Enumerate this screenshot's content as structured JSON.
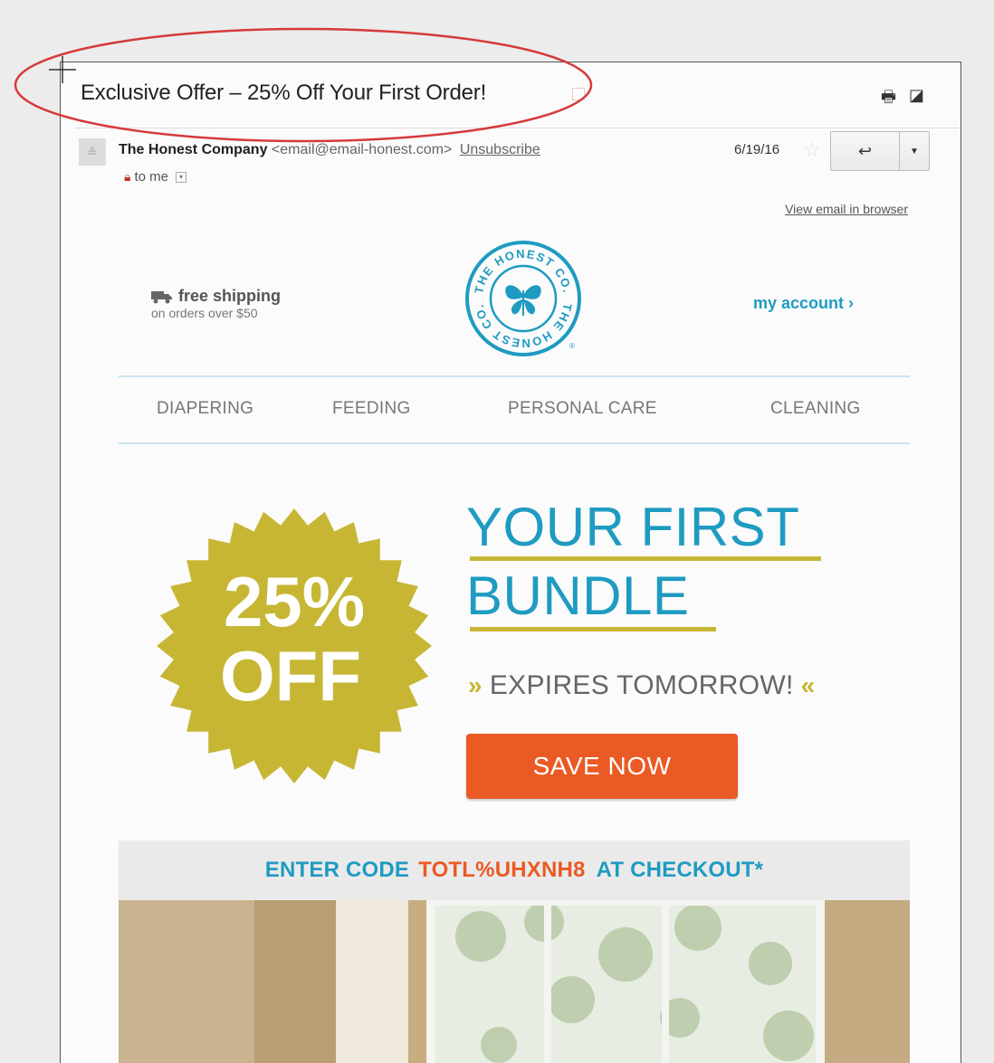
{
  "email": {
    "subject": "Exclusive Offer – 25% Off Your First Order!",
    "sender_name": "The Honest Company",
    "sender_email": "<email@email-honest.com>",
    "unsubscribe": "Unsubscribe",
    "recipient": "to me",
    "date": "6/19/16",
    "icons": {
      "print": "print-icon",
      "popout": "popout-icon",
      "reply": "reply-icon",
      "more": "dropdown-icon",
      "star": "star-icon",
      "lock": "lock-icon"
    }
  },
  "newsletter": {
    "view_in_browser": "View email in browser",
    "shipping_title": "free shipping",
    "shipping_sub": "on orders over $50",
    "logo_text_top": "THE HONEST CO.",
    "logo_text_bottom": "THE HONEST CO.",
    "account_link": "my account ›",
    "nav": [
      "DIAPERING",
      "FEEDING",
      "PERSONAL CARE",
      "CLEANING"
    ],
    "badge_line1": "25%",
    "badge_line2": "OFF",
    "headline_line1": "YOUR FIRST",
    "headline_line2": "BUNDLE",
    "expires_text": "EXPIRES TOMORROW!",
    "chevron_left": "»",
    "chevron_right": "«",
    "cta": "SAVE NOW",
    "code_prefix": "ENTER CODE",
    "code": "TOTL%UHXNH8",
    "code_suffix": "AT CHECKOUT*"
  },
  "colors": {
    "brand_blue": "#1f9bc1",
    "badge_gold": "#c7b634",
    "cta_orange": "#ea5a24",
    "annotation_red": "#d63a3a"
  }
}
